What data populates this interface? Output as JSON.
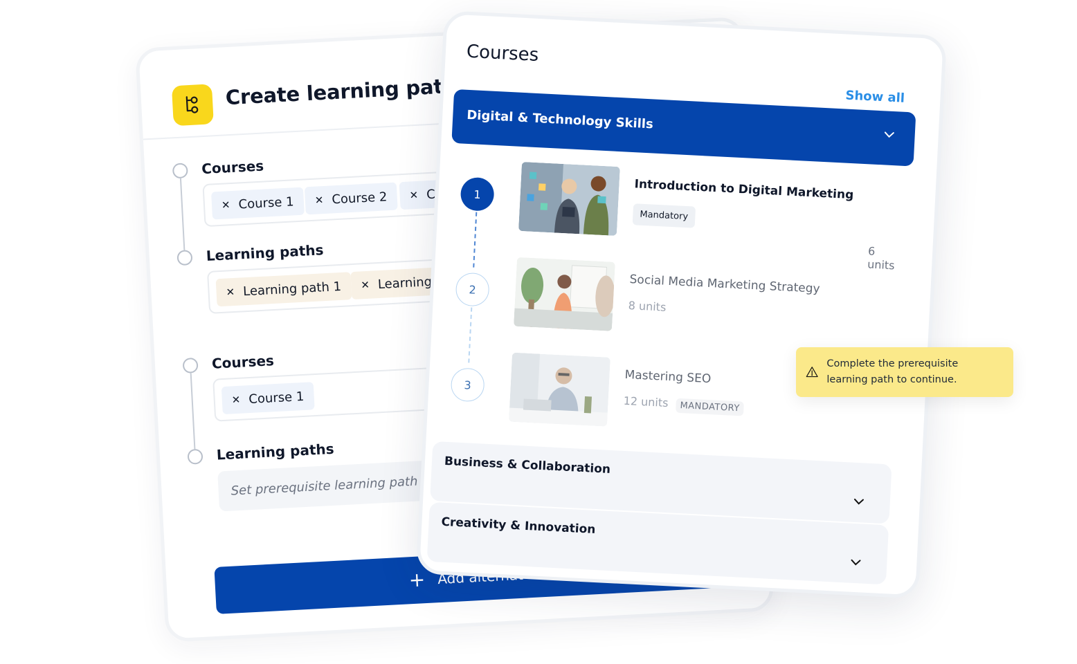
{
  "builder": {
    "title": "Create learning paths",
    "badge_icon": "learning-path-icon",
    "badge_color": "#f9d71c",
    "group1": {
      "courses_label": "Courses",
      "courses": [
        "Course 1",
        "Course 2",
        "Co"
      ],
      "paths_label": "Learning paths",
      "paths": [
        "Learning path 1",
        "Learning"
      ]
    },
    "group2": {
      "courses_label": "Courses",
      "courses": [
        "Course 1"
      ],
      "paths_label": "Learning paths",
      "paths_placeholder": "Set prerequisite learning path"
    },
    "add_button": {
      "label": "Add alternat"
    }
  },
  "courses_panel": {
    "title": "Courses",
    "show_all": "Show all",
    "accent_color": "#0545ac",
    "open_category": "Digital & Technology Skills",
    "items": [
      {
        "step": "1",
        "title": "Introduction to Digital Marketing",
        "tag": "Mandatory",
        "units": "6 units"
      },
      {
        "step": "2",
        "title": "Social Media Marketing Strategy",
        "units": "8 units"
      },
      {
        "step": "3",
        "title": "Mastering SEO",
        "units": "12 units",
        "tag": "MANDATORY"
      }
    ],
    "categories": [
      "Business & Collaboration",
      "Creativity & Innovation"
    ]
  },
  "toast": {
    "icon": "warning-icon",
    "message": "Complete the prerequisite learning path to continue.",
    "color": "#fbe98a"
  }
}
